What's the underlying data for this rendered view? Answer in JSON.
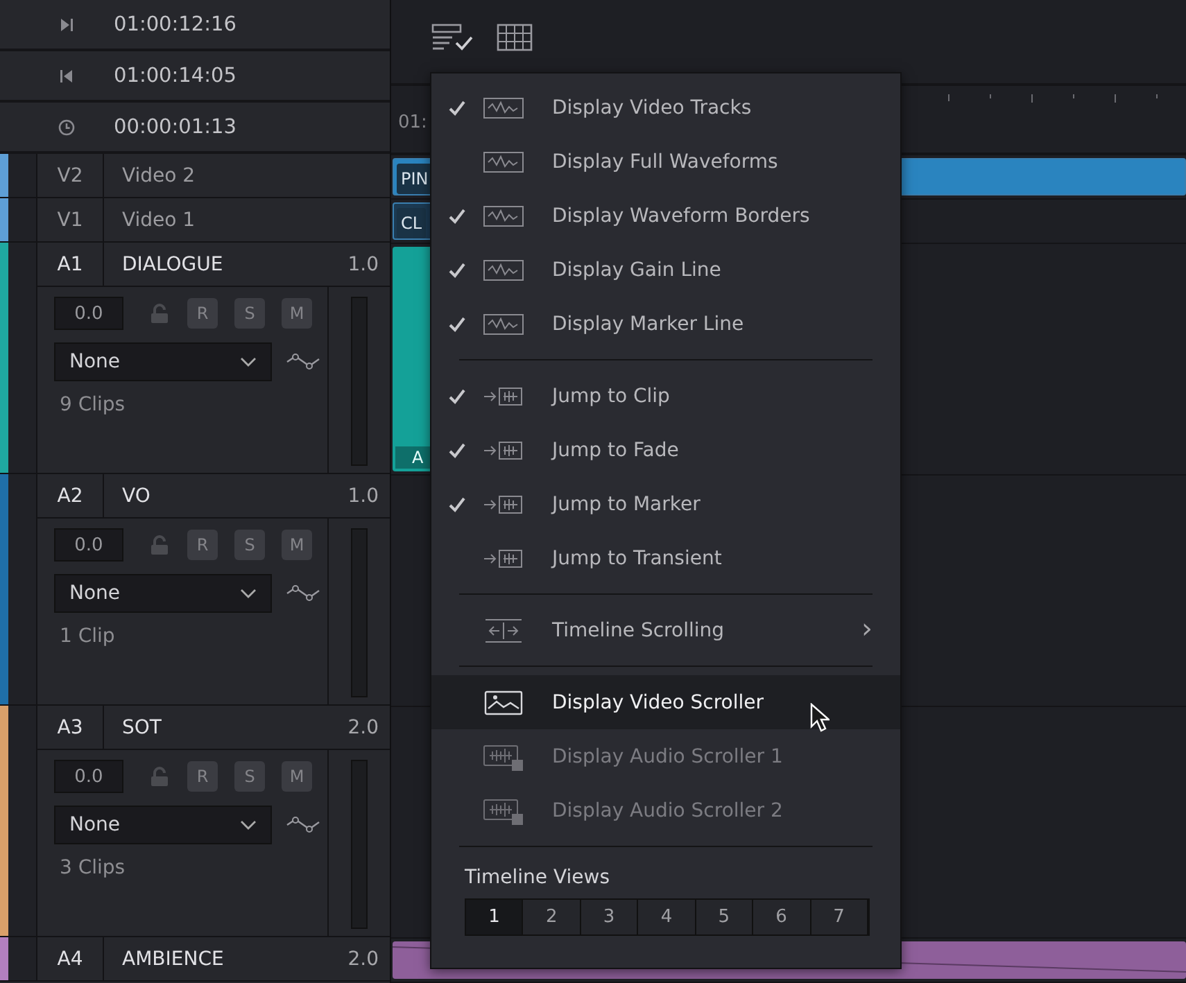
{
  "timecodes": [
    {
      "kind": "out",
      "value": "01:00:12:16"
    },
    {
      "kind": "in",
      "value": "01:00:14:05"
    },
    {
      "kind": "duration",
      "value": "00:00:01:13"
    }
  ],
  "tracks": [
    {
      "kind": "video",
      "id": "V2",
      "name": "Video 2",
      "color": "#5e9fd6",
      "clip": {
        "label": "PIN",
        "color": "#2a84bf",
        "extends": true
      }
    },
    {
      "kind": "video",
      "id": "V1",
      "name": "Video 1",
      "color": "#5e9fd6",
      "clip": {
        "label": "CL",
        "color": "#1c3a52",
        "extends": false
      }
    },
    {
      "kind": "audio",
      "id": "A1",
      "name": "DIALOGUE",
      "channels": "1.0",
      "color": "#1fa8a0",
      "gain": "0.0",
      "buttons": [
        "R",
        "S",
        "M"
      ],
      "effect": "None",
      "clips": "9 Clips",
      "clip": {
        "label": "A",
        "color": "#14a198",
        "extends": false
      }
    },
    {
      "kind": "audio",
      "id": "A2",
      "name": "VO",
      "channels": "1.0",
      "color": "#1f6fa8",
      "gain": "0.0",
      "buttons": [
        "R",
        "S",
        "M"
      ],
      "effect": "None",
      "clips": "1 Clip"
    },
    {
      "kind": "audio",
      "id": "A3",
      "name": "SOT",
      "channels": "2.0",
      "color": "#d9a06a",
      "gain": "0.0",
      "buttons": [
        "R",
        "S",
        "M"
      ],
      "effect": "None",
      "clips": "3 Clips"
    },
    {
      "kind": "audio",
      "id": "A4",
      "name": "AMBIENCE",
      "channels": "2.0",
      "color": "#b27fbf",
      "clip": {
        "color": "#8e5f9a",
        "extends": true
      }
    }
  ],
  "ruler": "01:",
  "menu": {
    "sections": [
      {
        "items": [
          {
            "kind": "toggle",
            "label": "Display Video Tracks",
            "checked": true
          },
          {
            "kind": "toggle",
            "label": "Display Full Waveforms",
            "checked": false
          },
          {
            "kind": "toggle",
            "label": "Display Waveform Borders",
            "checked": true
          },
          {
            "kind": "toggle",
            "label": "Display Gain Line",
            "checked": true
          },
          {
            "kind": "toggle",
            "label": "Display Marker Line",
            "checked": true
          }
        ]
      },
      {
        "items": [
          {
            "kind": "toggle",
            "label": "Jump to Clip",
            "checked": true
          },
          {
            "kind": "toggle",
            "label": "Jump to Fade",
            "checked": true
          },
          {
            "kind": "toggle",
            "label": "Jump to Marker",
            "checked": true
          },
          {
            "kind": "toggle",
            "label": "Jump to Transient",
            "checked": false
          }
        ]
      },
      {
        "items": [
          {
            "kind": "submenu",
            "label": "Timeline Scrolling",
            "chevron": "›"
          }
        ]
      },
      {
        "items": [
          {
            "kind": "option",
            "label": "Display Video Scroller",
            "selected": true,
            "disabled": false
          },
          {
            "kind": "option",
            "label": "Display Audio Scroller 1",
            "selected": false,
            "disabled": true
          },
          {
            "kind": "option",
            "label": "Display Audio Scroller 2",
            "selected": false,
            "disabled": true
          }
        ]
      }
    ],
    "views": {
      "title": "Timeline Views",
      "buttons": [
        {
          "label": "1",
          "selected": true
        },
        {
          "label": "2",
          "selected": false
        },
        {
          "label": "3",
          "selected": false
        },
        {
          "label": "4",
          "selected": false
        },
        {
          "label": "5",
          "selected": false
        },
        {
          "label": "6",
          "selected": false
        },
        {
          "label": "7",
          "selected": false
        }
      ]
    }
  }
}
